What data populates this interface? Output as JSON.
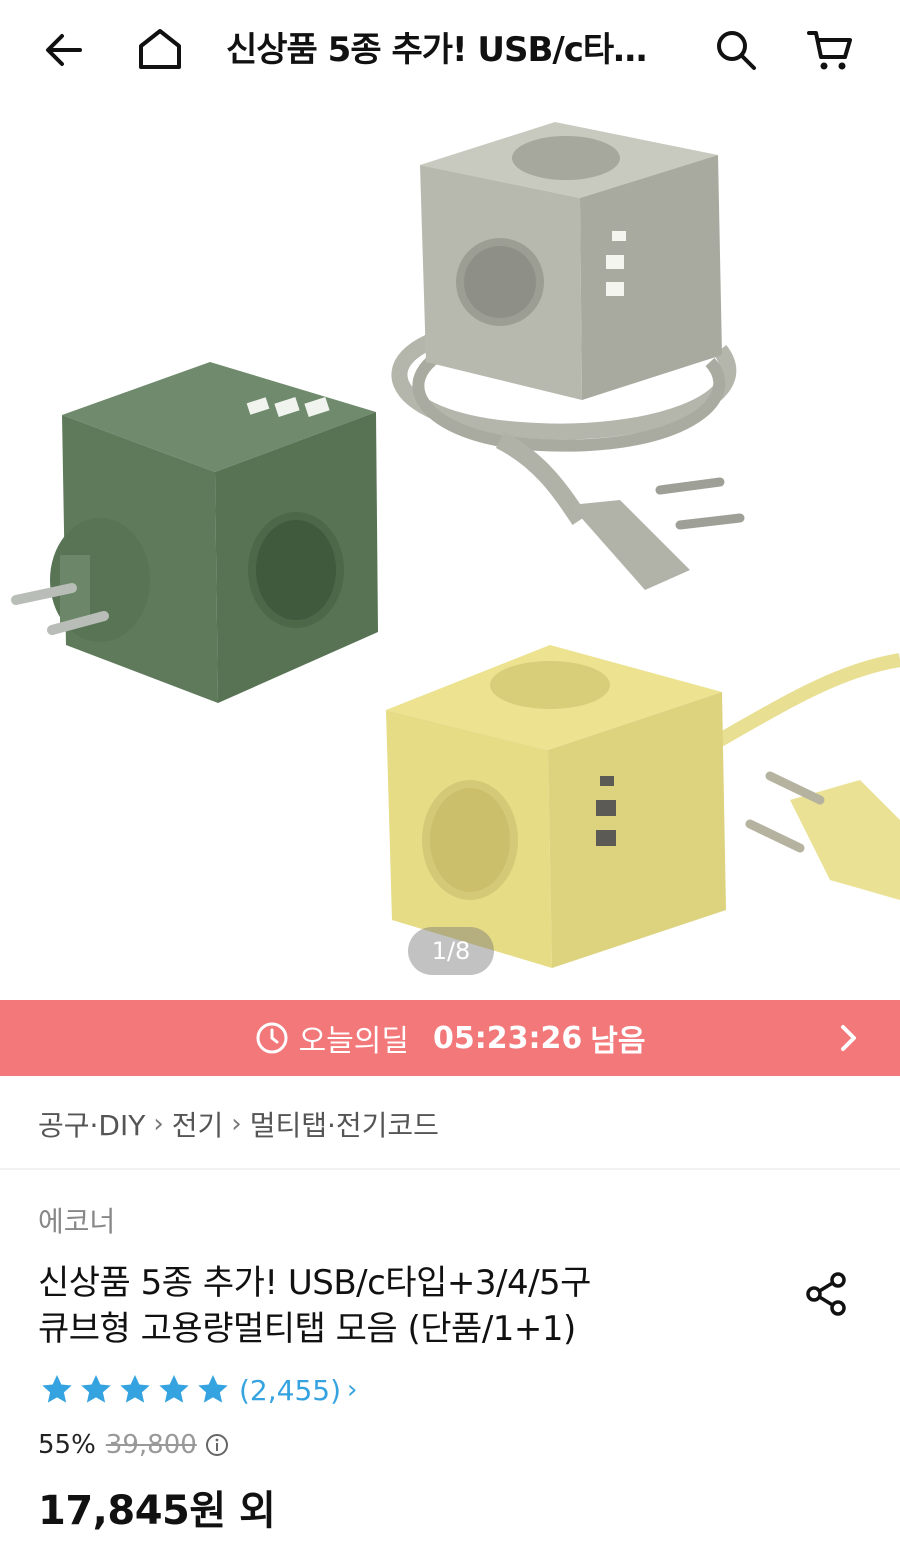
{
  "header": {
    "title": "신상품 5종 추가! USB/c타입+3/4/5구 큐브형 고용량멀티탭 모음 (단품/1+1)",
    "icons": [
      "back-arrow-icon",
      "home-icon",
      "search-icon",
      "cart-icon"
    ]
  },
  "gallery": {
    "pager": "1/8"
  },
  "deal_banner": {
    "label": "오늘의딜",
    "countdown": "05:23:26",
    "remain": "남음",
    "background": "#f2787a"
  },
  "breadcrumb": [
    "공구·DIY",
    "전기",
    "멀티탭·전기코드"
  ],
  "product": {
    "brand": "에코너",
    "name_line1": "신상품 5종 추가! USB/c타입+3/4/5구",
    "name_line2": "큐브형 고용량멀티탭 모음 (단품/1+1)",
    "rating_stars": 5,
    "review_count": "(2,455)",
    "discount": "55%",
    "original_price": "39,800",
    "price": "17,845원 외"
  },
  "colors": {
    "accent_blue": "#35a3e0",
    "star_blue": "#35a3e0"
  }
}
